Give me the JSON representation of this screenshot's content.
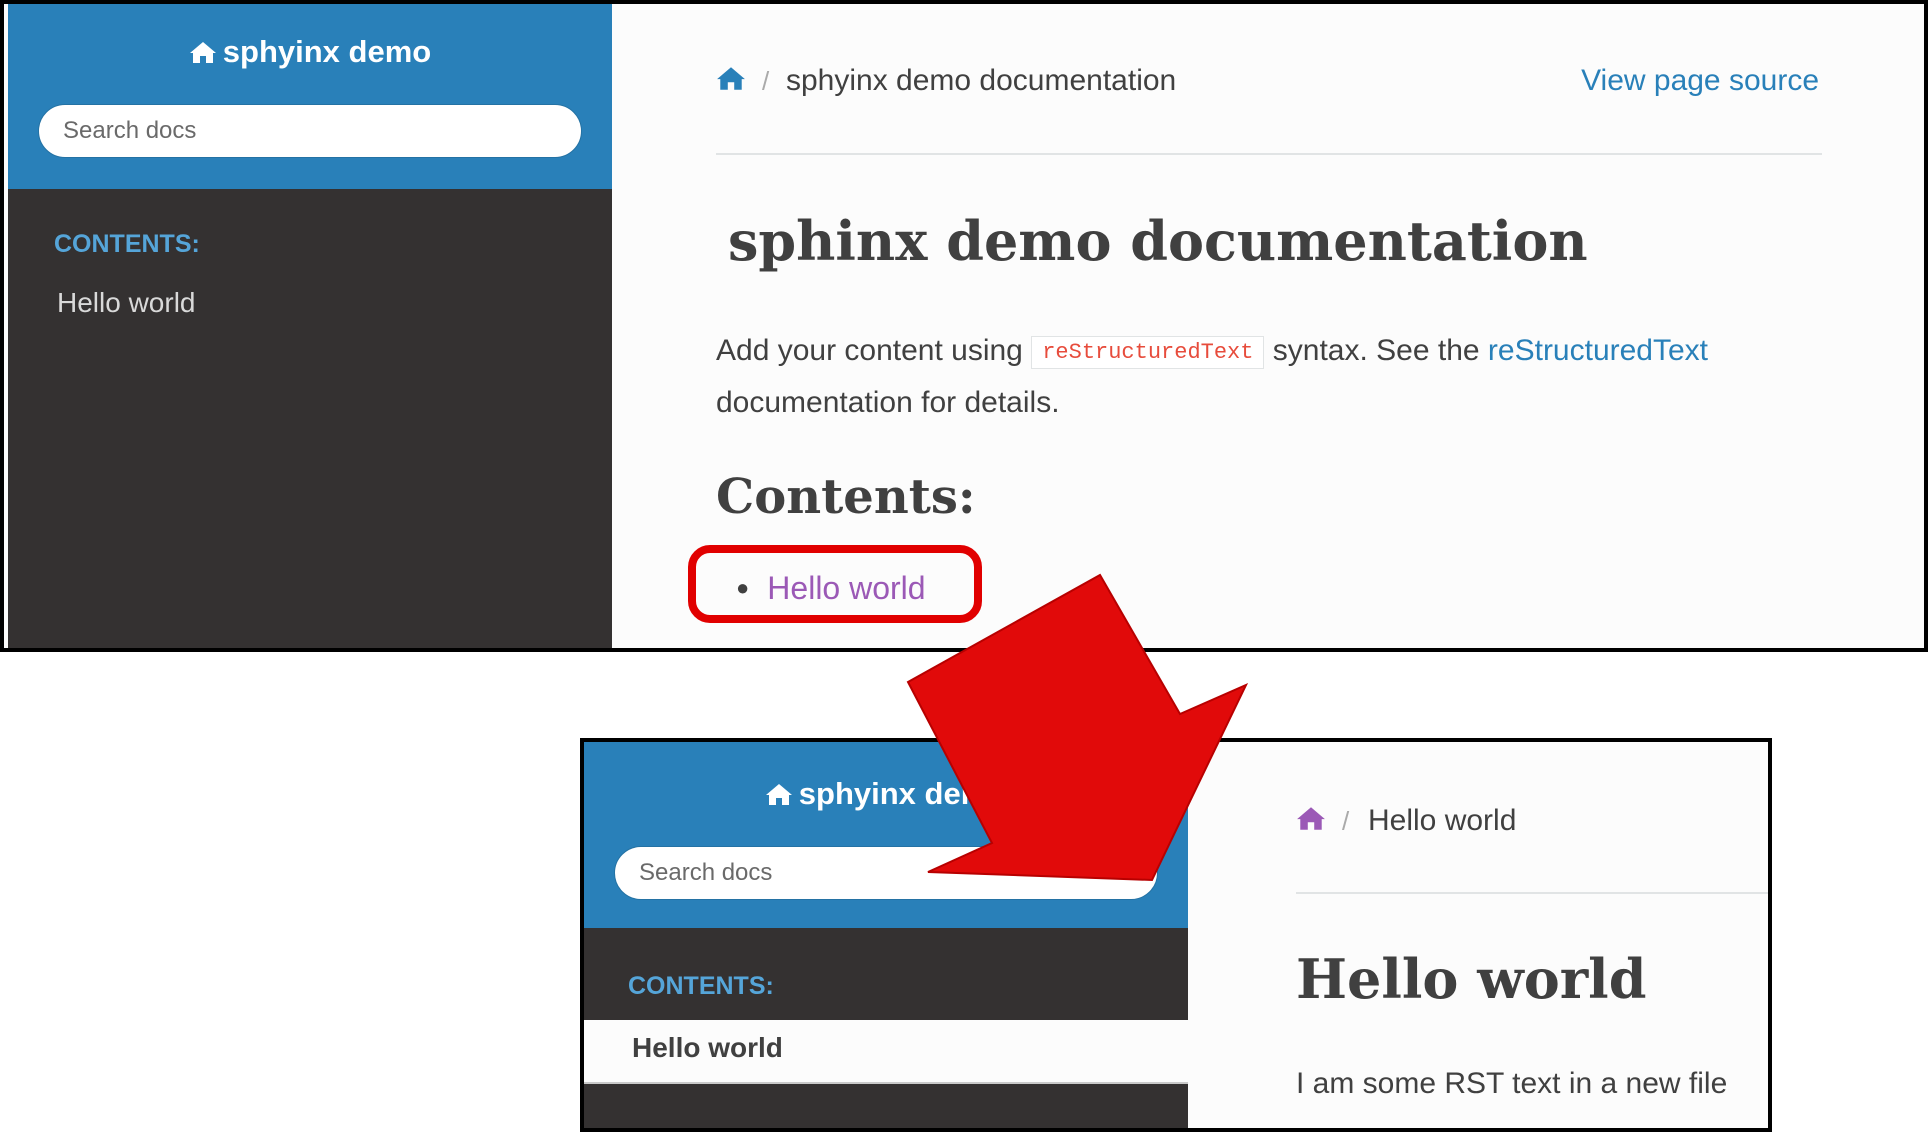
{
  "before": {
    "sidebar": {
      "project_name": "sphyinx demo",
      "search_placeholder": "Search docs",
      "caption": "CONTENTS:",
      "items": [
        {
          "label": "Hello world"
        }
      ]
    },
    "breadcrumb": {
      "page": "sphyinx demo documentation",
      "separator": "/"
    },
    "view_source_label": "View page source",
    "title": "sphinx demo documentation",
    "paragraph": {
      "before_code": "Add your content using ",
      "code": "reStructuredText",
      "middle": " syntax. See the ",
      "link": "reStructuredText",
      "after_link": " documentation for details."
    },
    "contents_heading": "Contents:",
    "toc": [
      {
        "label": "Hello world"
      }
    ]
  },
  "after": {
    "sidebar": {
      "project_name": "sphyinx demo",
      "search_placeholder": "Search docs",
      "caption": "CONTENTS:",
      "current_item": "Hello world"
    },
    "breadcrumb": {
      "page": "Hello world",
      "separator": "/"
    },
    "title": "Hello world",
    "body_text": "I am some RST text in a new file"
  },
  "colors": {
    "sidebar_blue": "#2980b9",
    "sidebar_dark": "#343131",
    "link_blue": "#2980b9",
    "visited_purple": "#9b59b6",
    "caption_blue": "#55a5d9",
    "highlight_red": "#e10000",
    "code_red": "#e74c3c"
  },
  "icons": {
    "home": "home-icon",
    "pointer": "arrow-icon"
  }
}
